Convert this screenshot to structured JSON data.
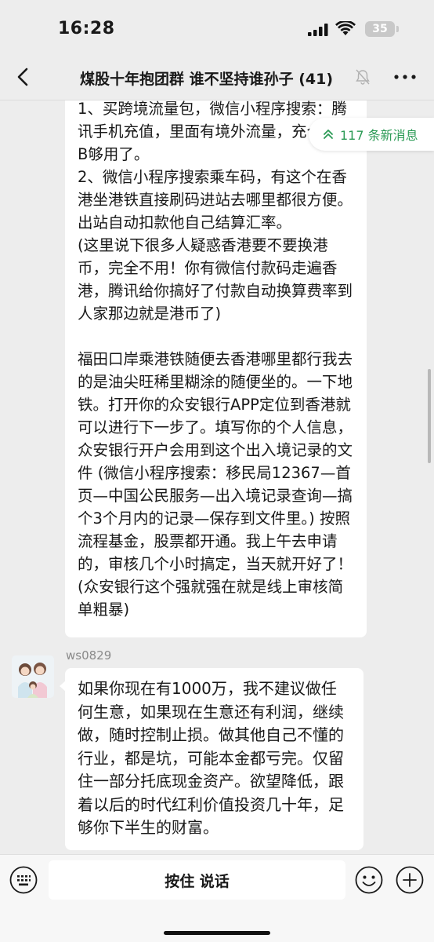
{
  "status_bar": {
    "time": "16:28",
    "battery": "35"
  },
  "nav": {
    "title": "煤股十年抱团群 谁不坚持谁孙子 (41)"
  },
  "new_messages": {
    "label": "117 条新消息"
  },
  "messages": [
    {
      "text": "1、买跨境流量包，微信小程序搜索：腾讯手机充值，里面有境外流量，充个几GB够用了。\n2、微信小程序搜索乘车码，有这个在香港坐港铁直接刷码进站去哪里都很方便。出站自动扣款他自己结算汇率。\n(这里说下很多人疑惑香港要不要换港币，完全不用！你有微信付款码走遍香港，腾讯给你搞好了付款自动换算费率到人家那边就是港币了)\n\n福田口岸乘港铁随便去香港哪里都行我去的是油尖旺稀里糊涂的随便坐的。一下地铁。打开你的众安银行APP定位到香港就可以进行下一步了。填写你的个人信息，众安银行开户会用到这个出入境记录的文件 (微信小程序搜索：移民局12367—首页—中国公民服务—出入境记录查询—搞个3个月内的记录—保存到文件里。) 按照流程基金，股票都开通。我上午去申请的，审核几个小时搞定，当天就开好了！(众安银行这个强就强在就是线上审核简单粗暴)"
    },
    {
      "sender": "ws0829",
      "text": "如果你现在有1000万，我不建议做任何生意，如果现在生意还有利润，继续做，随时控制止损。做其他自己不懂的行业，都是坑，可能本金都亏完。仅留住一部分托底现金资产。欲望降低，跟着以后的时代红利价值投资几十年，足够你下半生的财富。"
    }
  ],
  "input_bar": {
    "hold_to_talk": "按住 说话"
  },
  "colors": {
    "background": "#ededed",
    "bubble": "#ffffff",
    "accent_green": "#2b9a55",
    "text": "#191919",
    "muted": "#8a8a8a"
  },
  "icons": [
    "back-icon",
    "mute-icon",
    "more-icon",
    "keyboard-icon",
    "emoji-icon",
    "plus-icon",
    "signal-icon",
    "wifi-icon",
    "chevron-up-icon"
  ]
}
